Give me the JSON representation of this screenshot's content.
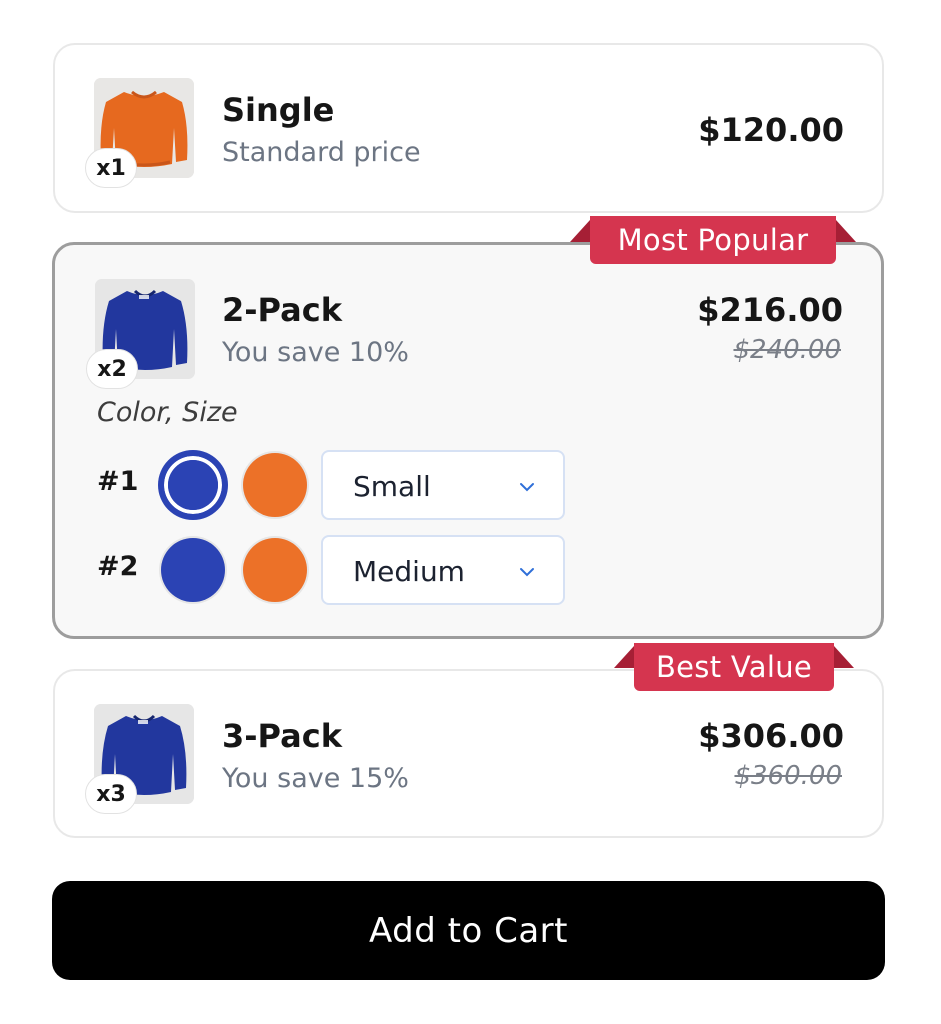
{
  "bundles": [
    {
      "title": "Single",
      "subtitle": "Standard price",
      "price": "$120.00",
      "compare_price": "",
      "qty_badge": "x1",
      "ribbon": "",
      "image": "orange-sweater",
      "selected": false
    },
    {
      "title": "2-Pack",
      "subtitle": "You save 10%",
      "price": "$216.00",
      "compare_price": "$240.00",
      "qty_badge": "x2",
      "ribbon": "Most Popular",
      "image": "blue-sweater",
      "selected": true,
      "variant_label": "Color, Size",
      "variants": [
        {
          "num": "#1",
          "selected_color": "blue",
          "size": "Small"
        },
        {
          "num": "#2",
          "selected_color": "blue",
          "size": "Medium"
        }
      ]
    },
    {
      "title": "3-Pack",
      "subtitle": "You save 15%",
      "price": "$306.00",
      "compare_price": "$360.00",
      "qty_badge": "x3",
      "ribbon": "Best Value",
      "image": "blue-sweater",
      "selected": false
    }
  ],
  "swatch_colors": {
    "blue": "#2b43b4",
    "orange": "#ec7128"
  },
  "ribbon_color": "#d5354f",
  "cta": {
    "label": "Add to Cart"
  },
  "icons": {
    "dropdown": "chevron-down-icon"
  }
}
